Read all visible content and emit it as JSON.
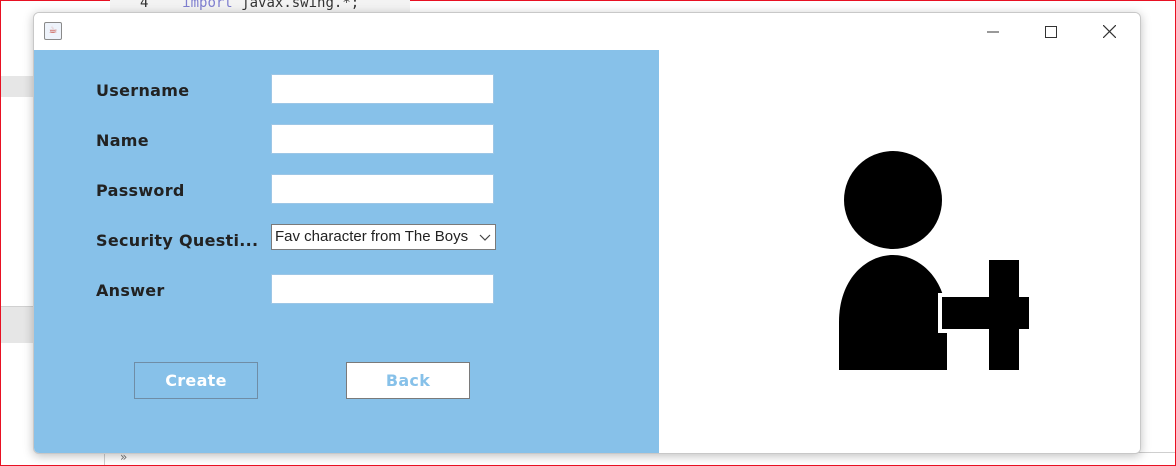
{
  "background": {
    "code_line_number": "4",
    "code_keyword": "import",
    "code_text": "javax.swing.*;"
  },
  "window": {
    "controls": {
      "minimize": "minimize-icon",
      "maximize": "maximize-icon",
      "close": "close-icon"
    }
  },
  "form": {
    "username_label": "Username",
    "name_label": "Name",
    "password_label": "Password",
    "security_label": "Security Questi...",
    "answer_label": "Answer",
    "username_value": "",
    "name_value": "",
    "password_value": "",
    "answer_value": "",
    "security_selected": "Fav character from The Boys"
  },
  "buttons": {
    "create": "Create",
    "back": "Back"
  },
  "colors": {
    "panel": "#87c1e9",
    "window_bg": "#ffffff",
    "icon": "#000000"
  },
  "illustration": {
    "icon": "add-user-icon"
  }
}
